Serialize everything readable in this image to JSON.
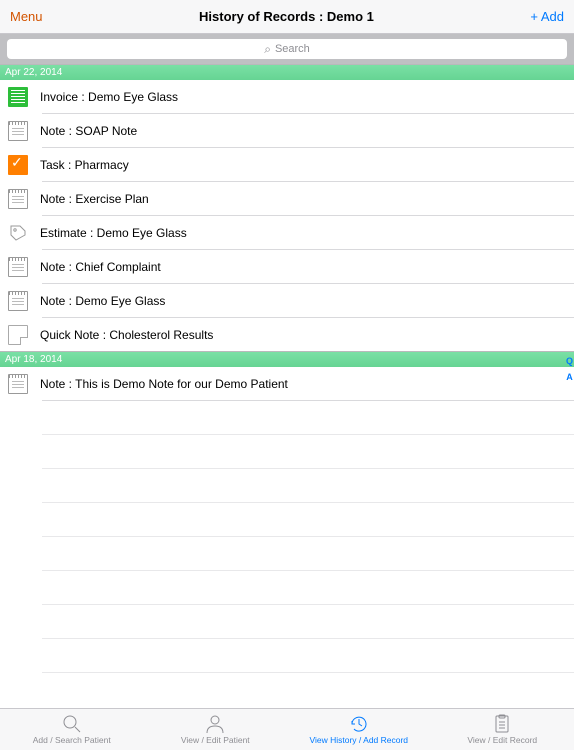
{
  "header": {
    "menu_label": "Menu",
    "title": "History of Records : Demo 1",
    "add_label": "+ Add"
  },
  "search": {
    "placeholder": "Search"
  },
  "sections": [
    {
      "date": "Apr 22, 2014",
      "records": [
        {
          "icon": "invoice",
          "text": "Invoice :  Demo Eye Glass"
        },
        {
          "icon": "note",
          "text": "Note :  SOAP Note"
        },
        {
          "icon": "task",
          "text": "Task :  Pharmacy"
        },
        {
          "icon": "note",
          "text": "Note :  Exercise Plan"
        },
        {
          "icon": "estimate",
          "text": "Estimate :  Demo Eye Glass"
        },
        {
          "icon": "note",
          "text": "Note :  Chief Complaint"
        },
        {
          "icon": "note",
          "text": "Note :  Demo Eye Glass"
        },
        {
          "icon": "quick",
          "text": "Quick Note :  Cholesterol Results"
        }
      ]
    },
    {
      "date": "Apr 18, 2014",
      "records": [
        {
          "icon": "note",
          "text": "Note : This is Demo Note for our Demo Patient"
        }
      ]
    }
  ],
  "side_index": [
    "Q",
    "A"
  ],
  "tabs": [
    {
      "label": "Add / Search Patient",
      "icon": "search",
      "active": false
    },
    {
      "label": "View / Edit Patient",
      "icon": "person",
      "active": false
    },
    {
      "label": "View History / Add Record",
      "icon": "history",
      "active": true
    },
    {
      "label": "View / Edit Record",
      "icon": "record",
      "active": false
    }
  ]
}
